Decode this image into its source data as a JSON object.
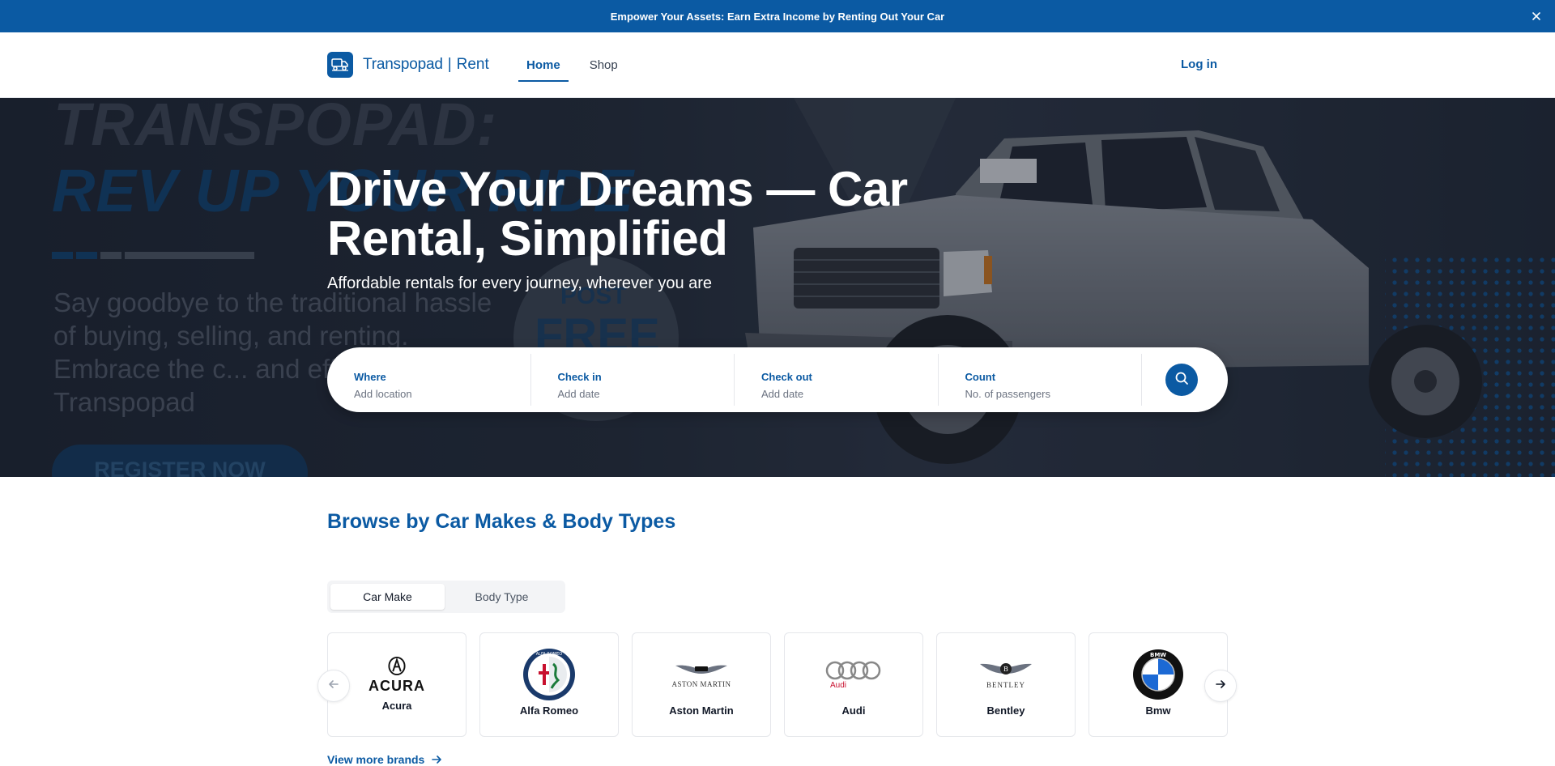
{
  "announcement": {
    "text": "Empower Your Assets: Earn Extra Income by Renting Out Your Car"
  },
  "header": {
    "brand": "Transpopad",
    "brand_separator": "|",
    "brand_sub": "Rent",
    "nav": [
      {
        "label": "Home",
        "active": true
      },
      {
        "label": "Shop",
        "active": false
      }
    ],
    "login_label": "Log in"
  },
  "hero": {
    "bg_title_line1": "TRANSPOPAD:",
    "bg_title_line2": "REV UP YOUR RIDE",
    "bg_paragraph": "Say goodbye to the traditional hassle of buying, selling, and renting. Embrace the c... and efficiency with Transpopad",
    "bg_badge_line1": "POST",
    "bg_badge_line2": "FREE",
    "bg_register": "REGISTER NOW",
    "title": "Drive Your Dreams — Car Rental, Simplified",
    "subtitle": "Affordable rentals for every journey, wherever you are"
  },
  "search": {
    "fields": [
      {
        "label": "Where",
        "placeholder": "Add location"
      },
      {
        "label": "Check in",
        "placeholder": "Add date"
      },
      {
        "label": "Check out",
        "placeholder": "Add date"
      },
      {
        "label": "Count",
        "placeholder": "No. of passengers"
      }
    ]
  },
  "browse": {
    "title": "Browse by Car Makes & Body Types",
    "tabs": [
      {
        "label": "Car Make",
        "active": true
      },
      {
        "label": "Body Type",
        "active": false
      }
    ],
    "makes": [
      {
        "name": "Acura",
        "logo_text": "ACURA"
      },
      {
        "name": "Alfa Romeo",
        "logo_text": "ALFA ROMEO"
      },
      {
        "name": "Aston Martin",
        "logo_text": "ASTON MARTIN"
      },
      {
        "name": "Audi",
        "logo_text": "Audi"
      },
      {
        "name": "Bentley",
        "logo_text": "BENTLEY"
      },
      {
        "name": "Bmw",
        "logo_text": "BMW"
      }
    ],
    "view_more_label": "View more brands"
  },
  "colors": {
    "brand_blue": "#0b5aa3",
    "hero_dark": "#1f2735"
  }
}
